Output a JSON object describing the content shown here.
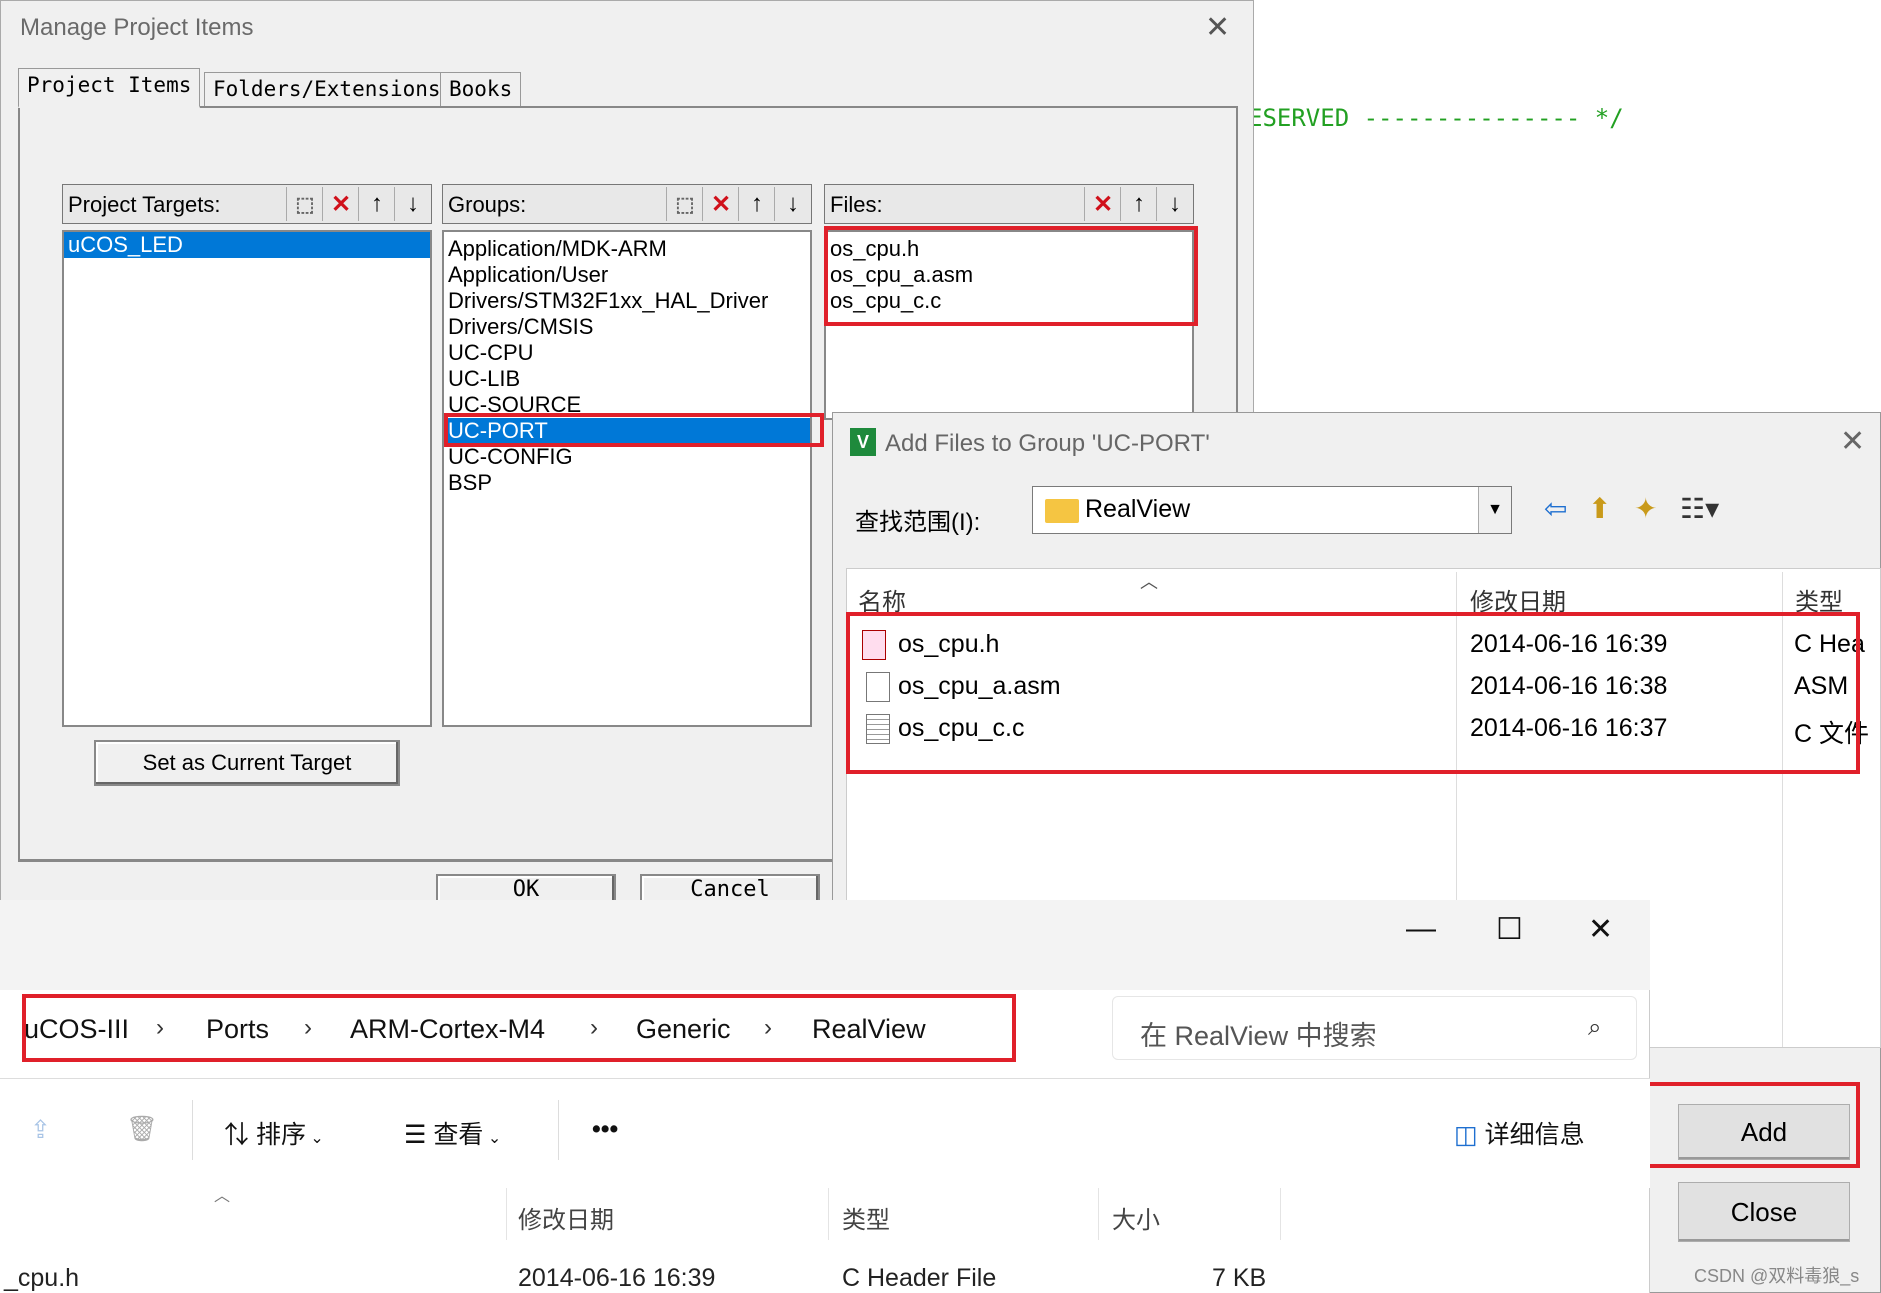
{
  "editor": {
    "code_line": "ESERVED --------------- */"
  },
  "manage_dialog": {
    "title": "Manage Project Items",
    "tabs": [
      "Project Items",
      "Folders/Extensions",
      "Books"
    ],
    "targets_label": "Project Targets:",
    "groups_label": "Groups:",
    "files_label": "Files:",
    "targets": [
      "uCOS_LED"
    ],
    "groups": [
      "Application/MDK-ARM",
      "Application/User",
      "Drivers/STM32F1xx_HAL_Driver",
      "Drivers/CMSIS",
      "UC-CPU",
      "UC-LIB",
      "UC-SOURCE",
      "UC-PORT",
      "UC-CONFIG",
      "BSP"
    ],
    "selected_group": "UC-PORT",
    "files": [
      "os_cpu.h",
      "os_cpu_a.asm",
      "os_cpu_c.c"
    ],
    "set_target_button": "Set as Current Target",
    "ok_button": "OK",
    "cancel_button": "Cancel"
  },
  "add_files_dialog": {
    "title": "Add Files to Group 'UC-PORT'",
    "look_in_label": "查找范围(I):",
    "look_in_value": "RealView",
    "columns": [
      "名称",
      "修改日期",
      "类型"
    ],
    "files": [
      {
        "name": "os_cpu.h",
        "date": "2014-06-16 16:39",
        "type": "C Hea"
      },
      {
        "name": "os_cpu_a.asm",
        "date": "2014-06-16 16:38",
        "type": "ASM :"
      },
      {
        "name": "os_cpu_c.c",
        "date": "2014-06-16 16:37",
        "type": "C 文件"
      }
    ],
    "add_button": "Add",
    "close_button": "Close"
  },
  "explorer": {
    "breadcrumbs": [
      "uCOS-III",
      "Ports",
      "ARM-Cortex-M4",
      "Generic",
      "RealView"
    ],
    "search_placeholder": "在 RealView 中搜索",
    "sort_label": "排序",
    "view_label": "查看",
    "more_label": "•••",
    "details_label": "详细信息",
    "columns": [
      "修改日期",
      "类型",
      "大小"
    ],
    "row": {
      "name": "_cpu.h",
      "date": "2014-06-16 16:39",
      "type": "C Header File",
      "size": "7 KB"
    }
  },
  "watermark": "CSDN @双料毒狼_s"
}
